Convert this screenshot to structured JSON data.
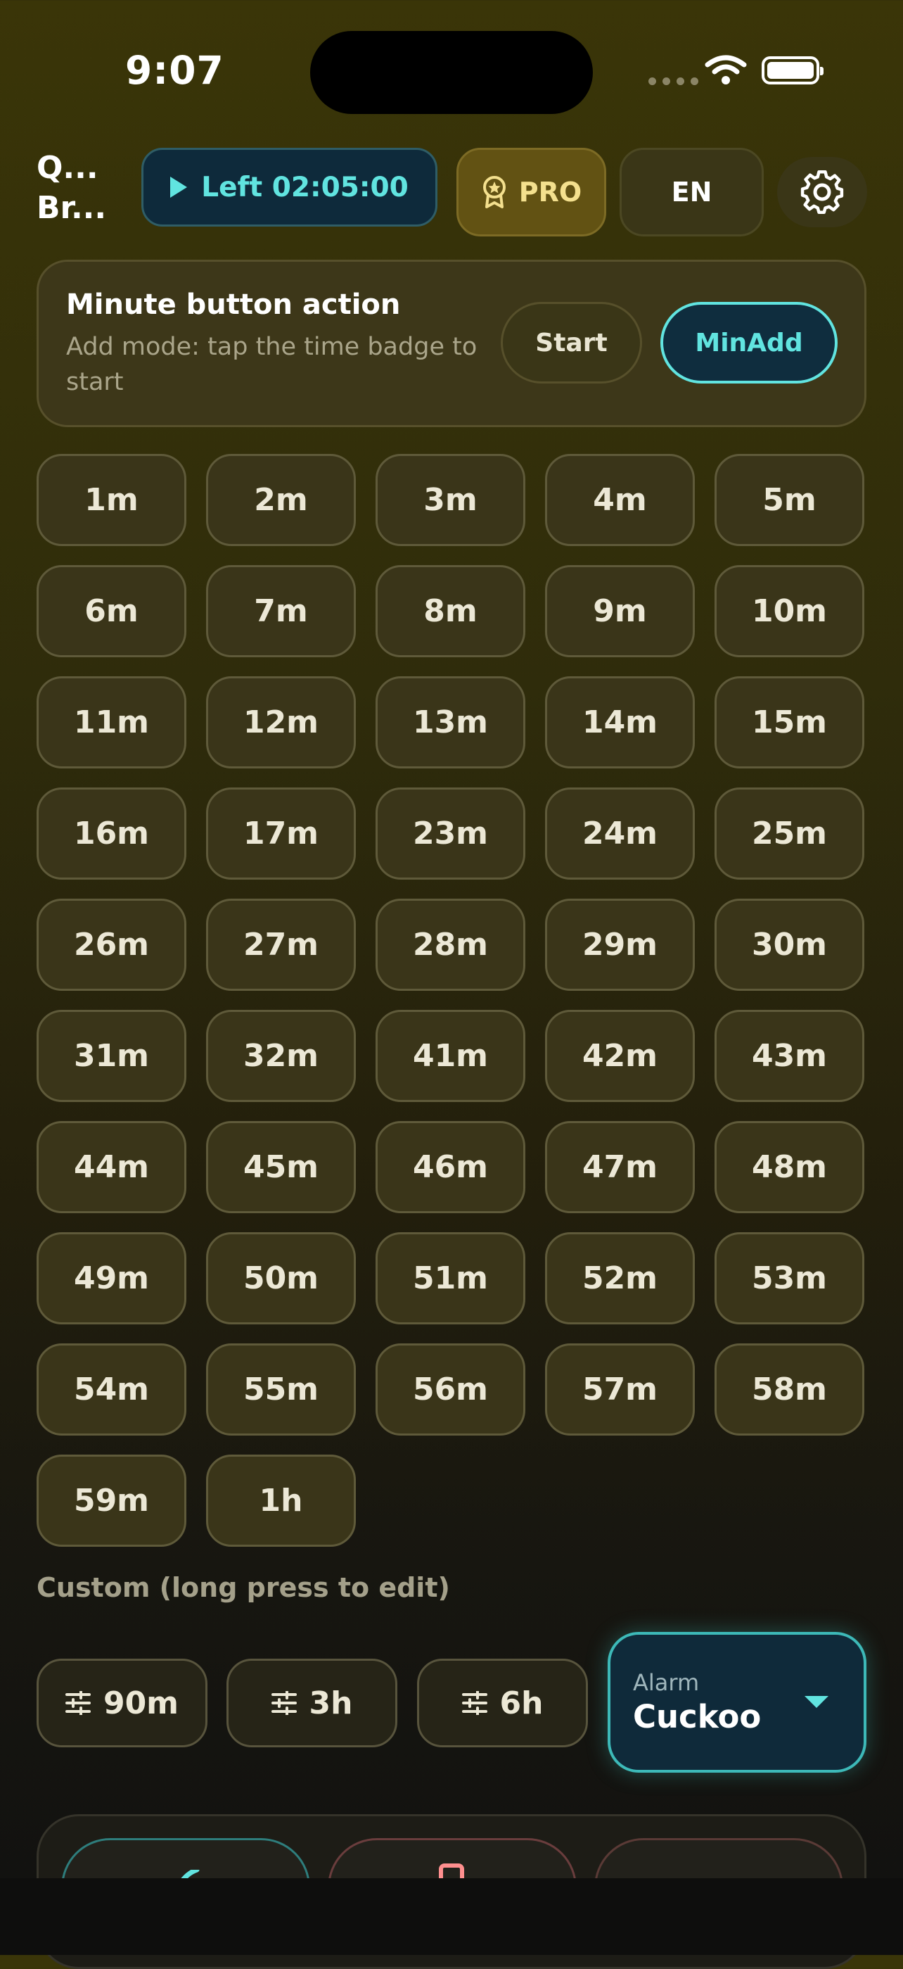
{
  "status_bar": {
    "time": "9:07"
  },
  "header": {
    "app_title_line1": "Q...",
    "app_title_line2": "Br...",
    "timer_label": "Left 02:05:00",
    "pro_label": "PRO",
    "language_label": "EN"
  },
  "mode_card": {
    "title": "Minute button action",
    "description": "Add mode: tap the time badge to start",
    "start_label": "Start",
    "minadd_label": "MinAdd",
    "selected": "MinAdd"
  },
  "minute_buttons": [
    "1m",
    "2m",
    "3m",
    "4m",
    "5m",
    "6m",
    "7m",
    "8m",
    "9m",
    "10m",
    "11m",
    "12m",
    "13m",
    "14m",
    "15m",
    "16m",
    "17m",
    "23m",
    "24m",
    "25m",
    "26m",
    "27m",
    "28m",
    "29m",
    "30m",
    "31m",
    "32m",
    "41m",
    "42m",
    "43m",
    "44m",
    "45m",
    "46m",
    "47m",
    "48m",
    "49m",
    "50m",
    "51m",
    "52m",
    "53m",
    "54m",
    "55m",
    "56m",
    "57m",
    "58m",
    "59m",
    "1h"
  ],
  "custom": {
    "label": "Custom (long press to edit)",
    "buttons": [
      "90m",
      "3h",
      "6h"
    ]
  },
  "alarm": {
    "label": "Alarm",
    "value": "Cuckoo"
  },
  "colors": {
    "accent": "#61e4e0",
    "pro": "#f4e08e",
    "background": "#2f2c0b"
  }
}
